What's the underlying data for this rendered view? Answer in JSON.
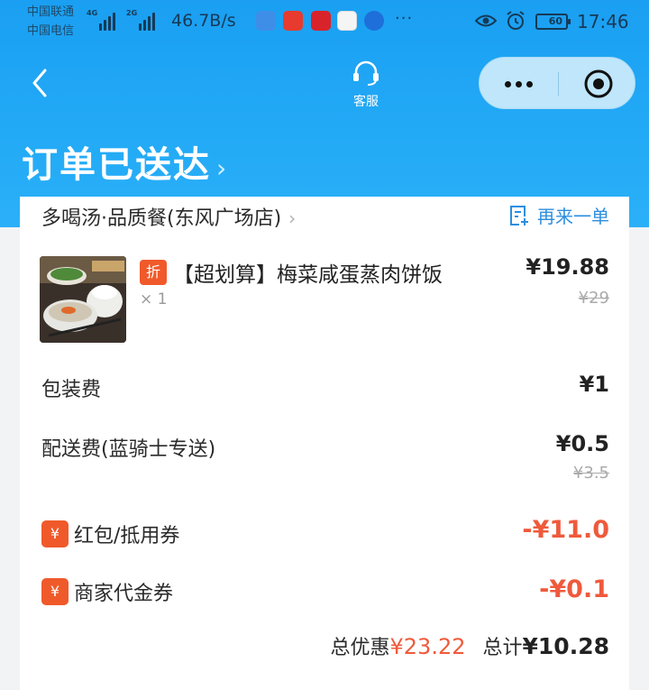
{
  "status_bar": {
    "carrier_1": "中国联通",
    "carrier_2": "中国电信",
    "net_1": "4G",
    "net_2": "2G",
    "speed": "46.7B/s",
    "battery": "60",
    "time": "17:46"
  },
  "nav": {
    "customer_service_label": "客服"
  },
  "header": {
    "title": "订单已送达",
    "title_chevron": "›"
  },
  "store": {
    "name": "多喝汤·品质餐(东风广场店)",
    "chevron": "›",
    "reorder_label": "再来一单"
  },
  "item": {
    "discount_badge": "折",
    "name": "【超划算】梅菜咸蛋蒸肉饼饭",
    "quantity": "× 1",
    "price": "¥19.88",
    "original_price": "¥29"
  },
  "fees": {
    "packaging_label": "包装费",
    "packaging_price": "¥1",
    "delivery_label": "配送费(蓝骑士专送)",
    "delivery_price": "¥0.5",
    "delivery_original_price": "¥3.5"
  },
  "discounts": {
    "badge": "¥",
    "coupon_label": "红包/抵用券",
    "coupon_amount": "-¥11.0",
    "merchant_label": "商家代金券",
    "merchant_amount": "-¥0.1"
  },
  "summary": {
    "discount_label": "总优惠",
    "discount_value": "¥23.22",
    "total_label": "总计",
    "total_value": "¥10.28"
  },
  "colors": {
    "header_blue": "#1a9ff2",
    "accent_red": "#ef5a3c",
    "link_blue": "#2b8ee0"
  }
}
